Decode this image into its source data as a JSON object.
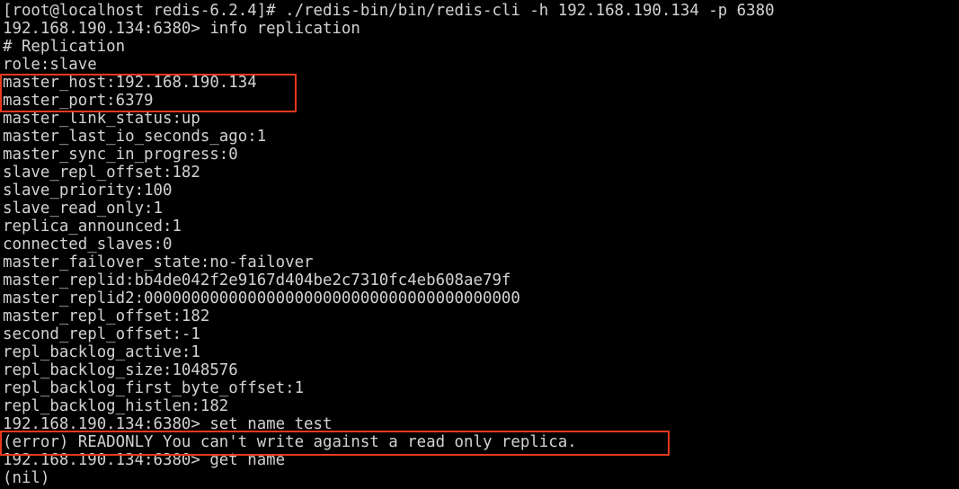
{
  "terminal": {
    "background": "#000000",
    "foreground": "#d2d2d2",
    "highlight_color": "#e8391f",
    "lines": [
      "[root@localhost redis-6.2.4]# ./redis-bin/bin/redis-cli -h 192.168.190.134 -p 6380",
      "192.168.190.134:6380> info replication",
      "# Replication",
      "role:slave",
      "master_host:192.168.190.134",
      "master_port:6379",
      "master_link_status:up",
      "master_last_io_seconds_ago:1",
      "master_sync_in_progress:0",
      "slave_repl_offset:182",
      "slave_priority:100",
      "slave_read_only:1",
      "replica_announced:1",
      "connected_slaves:0",
      "master_failover_state:no-failover",
      "master_replid:bb4de042f2e9167d404be2c7310fc4eb608ae79f",
      "master_replid2:0000000000000000000000000000000000000000",
      "master_repl_offset:182",
      "second_repl_offset:-1",
      "repl_backlog_active:1",
      "repl_backlog_size:1048576",
      "repl_backlog_first_byte_offset:1",
      "repl_backlog_histlen:182",
      "192.168.190.134:6380> set name test",
      "(error) READONLY You can't write against a read only replica.",
      "192.168.190.134:6380> get name",
      "(nil)"
    ]
  }
}
